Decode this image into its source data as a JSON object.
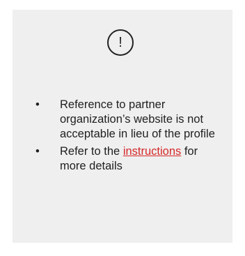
{
  "notice": {
    "icon": "exclamation-circle-icon",
    "icon_glyph": "!",
    "bullet_glyph": "•",
    "items": [
      {
        "text": "Reference to partner organization’s website is not acceptable in lieu of the profile"
      },
      {
        "prefix": "Refer to the ",
        "link_text": "instructions",
        "suffix": " for more details"
      }
    ]
  },
  "colors": {
    "card_background": "#efefef",
    "text": "#1f1f1f",
    "link": "#d62828"
  }
}
